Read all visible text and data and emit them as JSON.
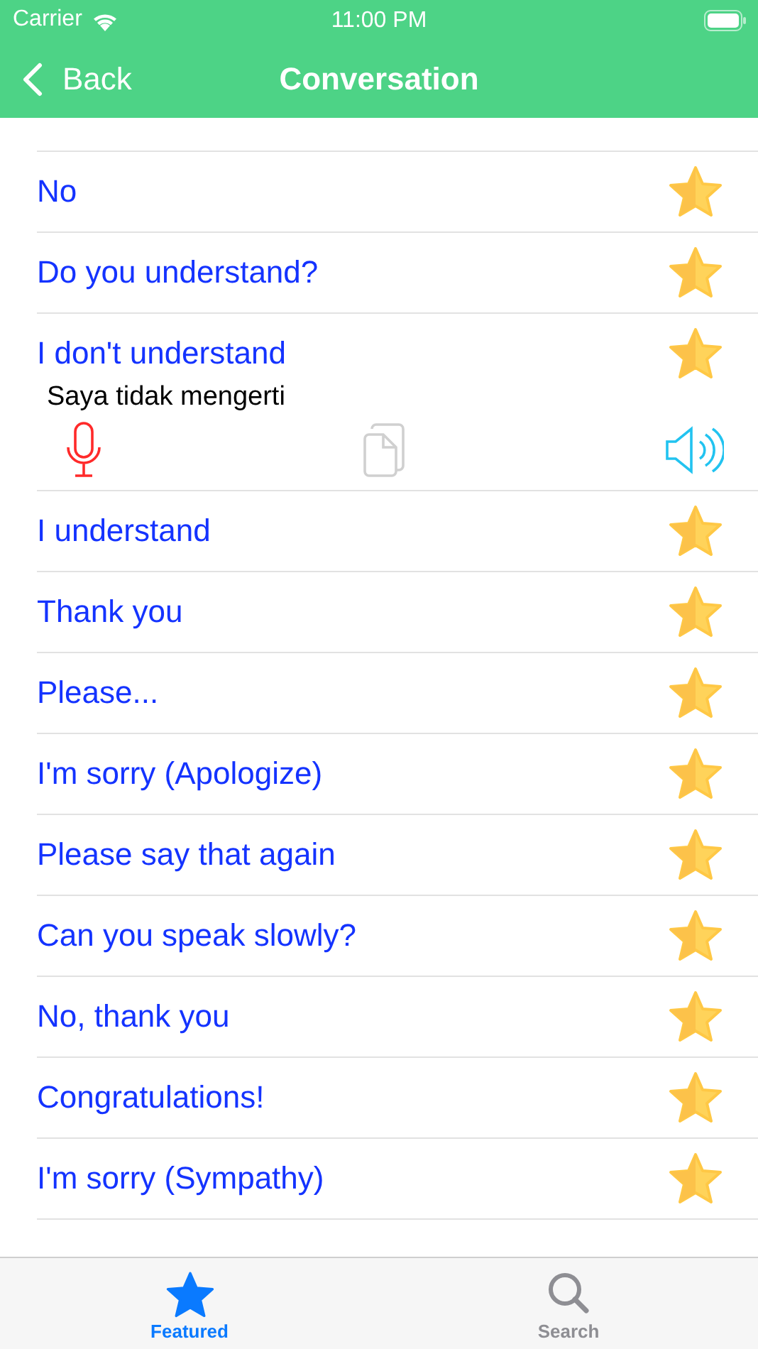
{
  "status_bar": {
    "carrier": "Carrier",
    "time": "11:00 PM"
  },
  "nav": {
    "back": "Back",
    "title": "Conversation"
  },
  "phrases": [
    {
      "text": "No",
      "favorite": true,
      "expanded": false
    },
    {
      "text": "Do you understand?",
      "favorite": true,
      "expanded": false
    },
    {
      "text": "I don't understand",
      "favorite": true,
      "expanded": true,
      "translation": "Saya tidak mengerti"
    },
    {
      "text": "I understand",
      "favorite": true,
      "expanded": false
    },
    {
      "text": "Thank you",
      "favorite": true,
      "expanded": false
    },
    {
      "text": "Please...",
      "favorite": true,
      "expanded": false
    },
    {
      "text": "I'm sorry (Apologize)",
      "favorite": true,
      "expanded": false
    },
    {
      "text": "Please say that again",
      "favorite": true,
      "expanded": false
    },
    {
      "text": "Can you speak slowly?",
      "favorite": true,
      "expanded": false
    },
    {
      "text": "No, thank you",
      "favorite": true,
      "expanded": false
    },
    {
      "text": "Congratulations!",
      "favorite": true,
      "expanded": false
    },
    {
      "text": "I'm sorry (Sympathy)",
      "favorite": true,
      "expanded": false
    }
  ],
  "tabs": [
    {
      "label": "Featured",
      "kind": "star",
      "selected": true
    },
    {
      "label": "Search",
      "kind": "search",
      "selected": false
    }
  ]
}
